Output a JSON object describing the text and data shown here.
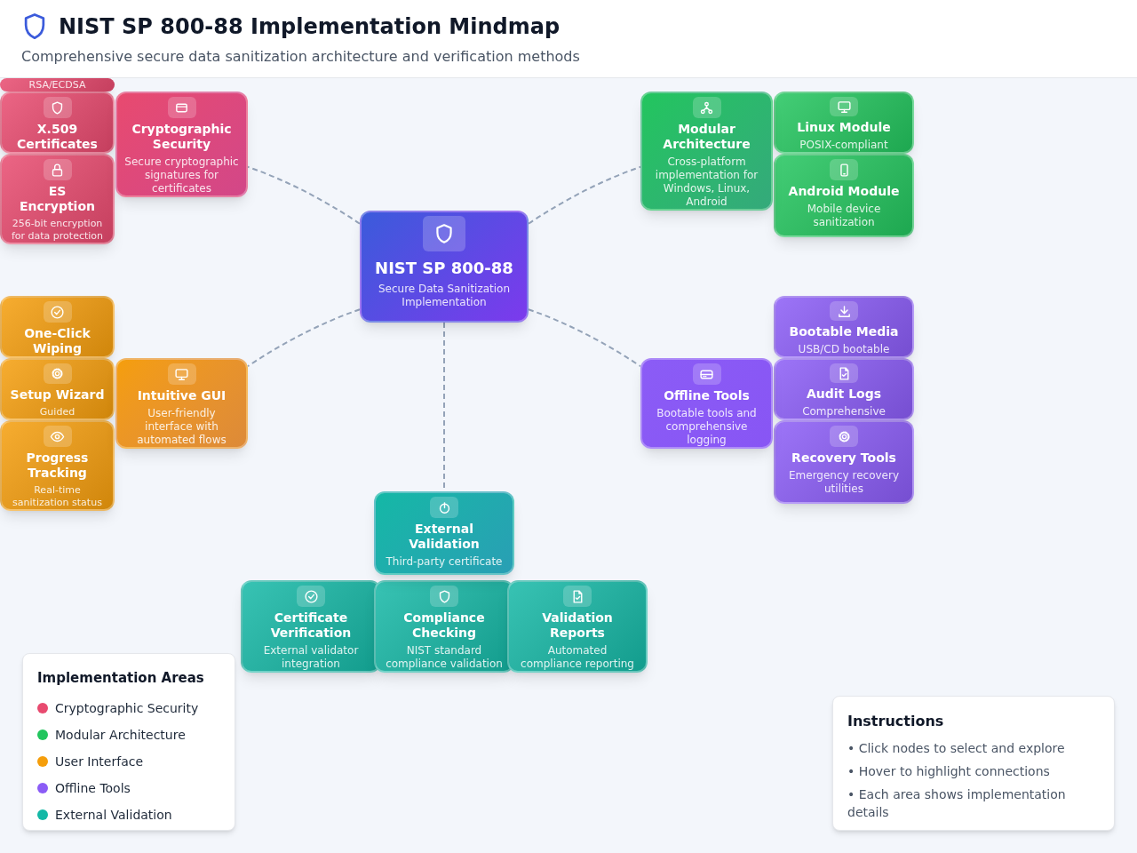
{
  "header": {
    "title": "NIST SP 800-88 Implementation Mindmap",
    "subtitle": "Comprehensive secure data sanitization architecture and verification methods"
  },
  "mindmap": {
    "center": {
      "title": "NIST SP 800-88",
      "description": "Secure Data Sanitization Implementation"
    },
    "branches": [
      {
        "title": "Cryptographic Security",
        "description": "Secure cryptographic signatures for certificates",
        "color": "#e84a6f",
        "children": [
          {
            "description": "RSA/ECDSA"
          },
          {
            "title": "X.509 Certificates"
          },
          {
            "title": "ES Encryption",
            "description": "256-bit encryption for data protection"
          }
        ]
      },
      {
        "title": "Modular Architecture",
        "description": "Cross-platform implementation for Windows, Linux, Android",
        "color": "#22c55e",
        "children": [
          {
            "title": "Linux Module",
            "description": "POSIX-compliant"
          },
          {
            "title": "Android Module",
            "description": "Mobile device sanitization"
          }
        ]
      },
      {
        "title": "Intuitive GUI",
        "description": "User-friendly interface with automated flows",
        "color": "#f59e0b",
        "children": [
          {
            "title": "One-Click Wiping"
          },
          {
            "title": "Setup Wizard",
            "description": "Guided"
          },
          {
            "title": "Progress Tracking",
            "description": "Real-time sanitization status"
          }
        ]
      },
      {
        "title": "Offline Tools",
        "description": "Bootable tools and comprehensive logging",
        "color": "#8b5cf6",
        "children": [
          {
            "title": "Bootable Media",
            "description": "USB/CD bootable"
          },
          {
            "title": "Audit Logs",
            "description": "Comprehensive"
          },
          {
            "title": "Recovery Tools",
            "description": "Emergency recovery utilities"
          }
        ]
      },
      {
        "title": "External Validation",
        "description": "Third-party certificate",
        "color": "#14b8a6",
        "children": [
          {
            "title": "Certificate Verification",
            "description": "External validator integration"
          },
          {
            "title": "Compliance Checking",
            "description": "NIST standard compliance validation"
          },
          {
            "title": "Validation Reports",
            "description": "Automated compliance reporting"
          }
        ]
      }
    ]
  },
  "legend": {
    "title": "Implementation Areas",
    "items": [
      {
        "label": "Cryptographic Security",
        "color": "#e84a6f"
      },
      {
        "label": "Modular Architecture",
        "color": "#22c55e"
      },
      {
        "label": "User Interface",
        "color": "#f59e0b"
      },
      {
        "label": "Offline Tools",
        "color": "#8b5cf6"
      },
      {
        "label": "External Validation",
        "color": "#14b8a6"
      }
    ]
  },
  "instructions": {
    "title": "Instructions",
    "items": [
      "• Click nodes to select and explore",
      "• Hover to highlight connections",
      "• Each area shows implementation details"
    ]
  }
}
